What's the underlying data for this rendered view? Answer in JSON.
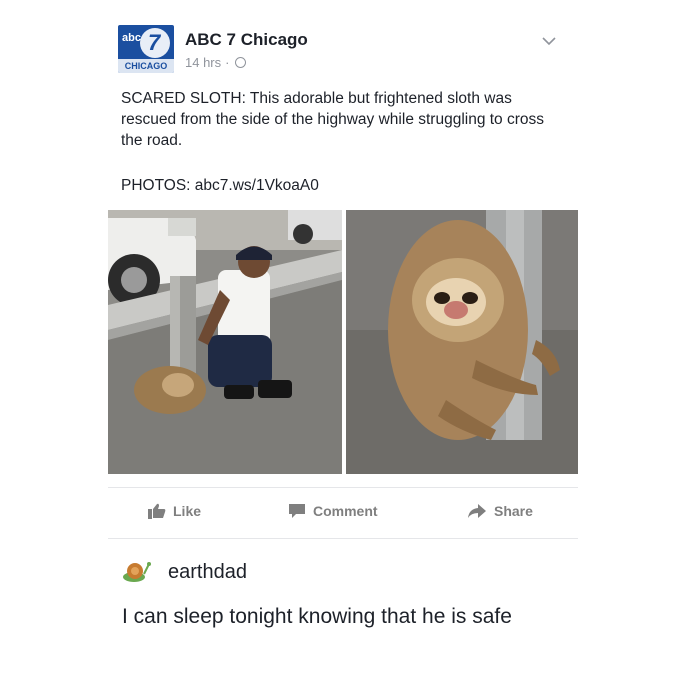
{
  "post": {
    "page_name": "ABC 7 Chicago",
    "logo": {
      "abc": "abc",
      "number": "7",
      "city": "CHICAGO"
    },
    "time": "14 hrs",
    "separator": "·",
    "text": "SCARED SLOTH: This adorable but frightened sloth was rescued from the side of the highway while struggling to cross the road.",
    "photos_line": "PHOTOS: abc7.ws/1VkoaA0",
    "photo_icons": [
      "officer-with-sloth-photo",
      "sloth-hugging-pole-photo"
    ]
  },
  "actions": {
    "like": "Like",
    "comment": "Comment",
    "share": "Share"
  },
  "reply": {
    "username": "earthdad",
    "text": "I can sleep tonight knowing that he is safe"
  },
  "colors": {
    "brand_blue": "#1b4fa0",
    "meta_gray": "#90949c",
    "action_gray": "#7f7f7f"
  }
}
